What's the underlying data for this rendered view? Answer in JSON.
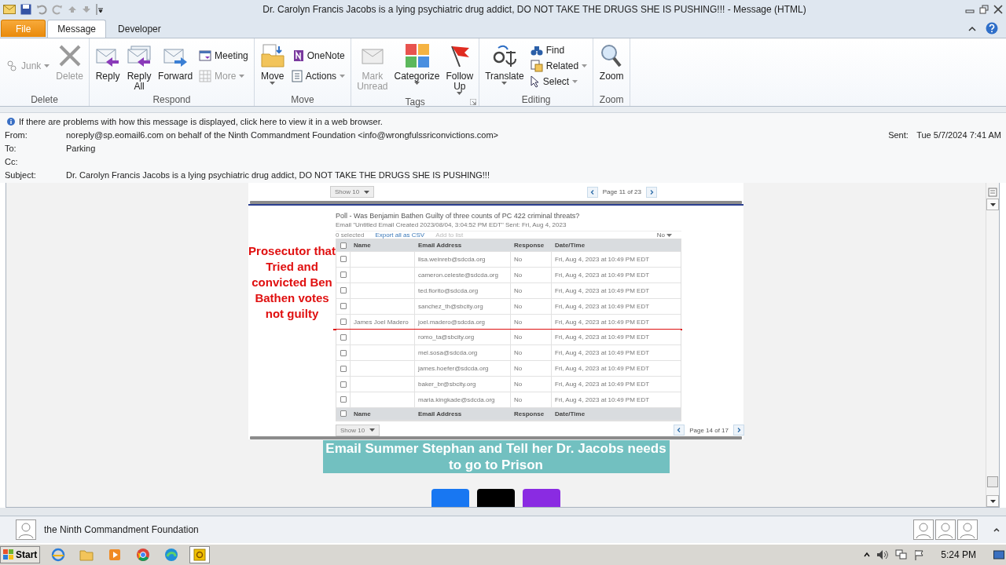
{
  "window": {
    "title": "Dr. Carolyn Francis Jacobs is a lying psychiatric drug addict, DO NOT TAKE THE DRUGS SHE IS PUSHING!!!  -  Message (HTML)"
  },
  "ribbon": {
    "tabs": [
      {
        "label": "File",
        "kind": "file",
        "selected": false
      },
      {
        "label": "Message",
        "kind": "tab",
        "selected": true
      },
      {
        "label": "Developer",
        "kind": "tab",
        "selected": false
      }
    ],
    "groups": [
      {
        "label": "Delete",
        "launcher": false,
        "buttons": [
          {
            "label": "Junk",
            "kind": "small",
            "disabled": true,
            "dropdown": true
          },
          {
            "label": "Delete",
            "kind": "large",
            "disabled": true,
            "dropdown": false
          }
        ]
      },
      {
        "label": "Respond",
        "launcher": false,
        "buttons": [
          {
            "label": "Reply",
            "kind": "large",
            "disabled": false,
            "dropdown": false
          },
          {
            "label": "Reply All",
            "kind": "large",
            "disabled": false,
            "dropdown": false
          },
          {
            "label": "Forward",
            "kind": "large",
            "disabled": false,
            "dropdown": false
          },
          {
            "label": "Meeting",
            "kind": "small",
            "disabled": false,
            "dropdown": false
          },
          {
            "label": "More",
            "kind": "small",
            "disabled": true,
            "dropdown": true
          }
        ]
      },
      {
        "label": "Move",
        "launcher": false,
        "buttons": [
          {
            "label": "Move",
            "kind": "large",
            "disabled": false,
            "dropdown": true
          },
          {
            "label": "OneNote",
            "kind": "small",
            "disabled": false,
            "dropdown": false
          },
          {
            "label": "Actions",
            "kind": "small",
            "disabled": false,
            "dropdown": true
          }
        ]
      },
      {
        "label": "Tags",
        "launcher": true,
        "buttons": [
          {
            "label": "Mark Unread",
            "kind": "large",
            "disabled": true,
            "dropdown": false
          },
          {
            "label": "Categorize",
            "kind": "large",
            "disabled": false,
            "dropdown": true
          },
          {
            "label": "Follow Up",
            "kind": "large",
            "disabled": false,
            "dropdown": true
          }
        ]
      },
      {
        "label": "Editing",
        "launcher": false,
        "buttons": [
          {
            "label": "Translate",
            "kind": "large",
            "disabled": false,
            "dropdown": true
          },
          {
            "label": "Find",
            "kind": "small",
            "disabled": false,
            "dropdown": false
          },
          {
            "label": "Related",
            "kind": "small",
            "disabled": false,
            "dropdown": true
          },
          {
            "label": "Select",
            "kind": "small",
            "disabled": false,
            "dropdown": true
          }
        ]
      },
      {
        "label": "Zoom",
        "launcher": false,
        "buttons": [
          {
            "label": "Zoom",
            "kind": "large",
            "disabled": false,
            "dropdown": false
          }
        ]
      }
    ]
  },
  "info_bar": {
    "text": "If there are problems with how this message is displayed, click here to view it in a web browser."
  },
  "header": {
    "fields": [
      {
        "label": "From:",
        "value": "noreply@sp.eomail6.com on behalf of the Ninth Commandment Foundation <info@wrongfulssriconvictions.com>"
      },
      {
        "label": "To:",
        "value": "Parking"
      },
      {
        "label": "Cc:"
      },
      {
        "label": "Subject:",
        "value": "Dr. Carolyn Francis Jacobs is a lying psychiatric drug addict, DO NOT TAKE THE DRUGS SHE IS PUSHING!!!"
      }
    ],
    "sent": {
      "label": "Sent:",
      "value": "Tue 5/7/2024 7:41 AM"
    }
  },
  "message": {
    "top_pager": {
      "show": "Show 10",
      "page": "Page 11 of 23"
    },
    "annotation_lines": [
      "Prosecutor that",
      "Tried and",
      "convicted Ben",
      "Bathen votes",
      "not guilty"
    ],
    "poll": {
      "title": "Poll - Was Benjamin Bathen Guilty of three counts of PC 422 criminal threats?",
      "subtitle": "Email \"Untitled Email Created 2023/08/04, 3:04:52 PM EDT\" Sent: Fri, Aug 4, 2023",
      "selected_count": "0 selected",
      "export": "Export all as CSV",
      "add": "Add to list",
      "filter": "No",
      "header_checked": false,
      "columns": [
        "Name",
        "Email Address",
        "Response",
        "Date/Time"
      ],
      "rows": [
        {
          "email": "lisa.weinreb@sdcda.org",
          "response": "No",
          "date": "Fri, Aug 4, 2023 at 10:49 PM EDT",
          "checked": false,
          "underlined": false
        },
        {
          "email": "cameron.celeste@sdcda.org",
          "response": "No",
          "date": "Fri, Aug 4, 2023 at 10:49 PM EDT",
          "checked": false,
          "underlined": false
        },
        {
          "email": "ted.fiorito@sdcda.org",
          "response": "No",
          "date": "Fri, Aug 4, 2023 at 10:49 PM EDT",
          "checked": false,
          "underlined": false
        },
        {
          "email": "sanchez_th@sbcity.org",
          "response": "No",
          "date": "Fri, Aug 4, 2023 at 10:49 PM EDT",
          "checked": false,
          "underlined": false
        },
        {
          "name": "James Joel Madero",
          "email": "joel.madero@sdcda.org",
          "response": "No",
          "date": "Fri, Aug 4, 2023 at 10:49 PM EDT",
          "checked": false,
          "underlined": true
        },
        {
          "email": "romo_ta@sbcity.org",
          "response": "No",
          "date": "Fri, Aug 4, 2023 at 10:49 PM EDT",
          "checked": false,
          "underlined": false
        },
        {
          "email": "mel.sosa@sdcda.org",
          "response": "No",
          "date": "Fri, Aug 4, 2023 at 10:49 PM EDT",
          "checked": false,
          "underlined": false
        },
        {
          "email": "james.hoefer@sdcda.org",
          "response": "No",
          "date": "Fri, Aug 4, 2023 at 10:49 PM EDT",
          "checked": false,
          "underlined": false
        },
        {
          "email": "baker_br@sbcity.org",
          "response": "No",
          "date": "Fri, Aug 4, 2023 at 10:49 PM EDT",
          "checked": false,
          "underlined": false
        },
        {
          "email": "maria.kingkade@sdcda.org",
          "response": "No",
          "date": "Fri, Aug 4, 2023 at 10:49 PM EDT",
          "checked": false,
          "underlined": false
        }
      ],
      "footer_checked": false,
      "footer_columns": [
        "Name",
        "Email Address",
        "Response",
        "Date/Time"
      ],
      "pager": {
        "show": "Show 10",
        "page": "Page 14 of 17"
      }
    },
    "banner": "Email Summer Stephan and Tell her Dr. Jacobs needs to go to Prison",
    "social": [
      {
        "color": "#1877f2"
      },
      {
        "color": "#000000"
      },
      {
        "color": "#8a2be2"
      }
    ]
  },
  "people_pane": {
    "name": "the Ninth Commandment Foundation"
  },
  "taskbar": {
    "start": "Start",
    "clock": "5:24 PM"
  }
}
